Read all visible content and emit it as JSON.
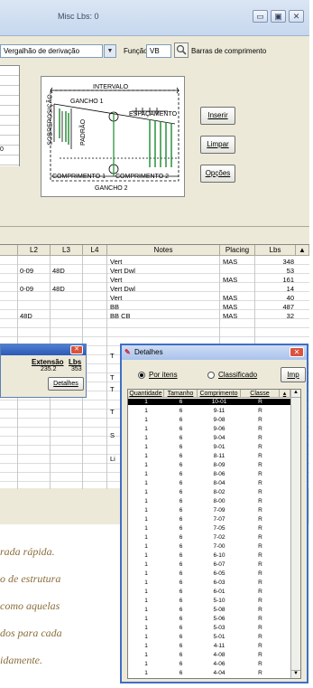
{
  "window": {
    "title": "Misc Lbs: 0",
    "minimize": "▭",
    "maximize": "▣",
    "close": "✕"
  },
  "toolbar": {
    "shape_value": "Vergalhão de derivação",
    "function_label": "Função",
    "function_value": "VB",
    "bars_label": "Barras de comprimento"
  },
  "left_panel": {
    "value": "0"
  },
  "diagram": {
    "intervalo": "INTERVALO",
    "gancho1": "GANCHO 1",
    "espacamento": "ESPAÇAMENTO",
    "sobreposicao": "SOBREPOSIÇÃO",
    "padrao": "PADRÃO",
    "comprimento1": "COMPRIMENTO 1",
    "comprimento2": "COMPRIMENTO 2",
    "gancho2": "GANCHO 2"
  },
  "buttons": {
    "inserir": "Inserir",
    "limpar": "Limpar",
    "opcoes": "Opções"
  },
  "grid": {
    "headers": [
      "L2",
      "L3",
      "L4",
      "Notes",
      "Placing",
      "Lbs"
    ],
    "rows": [
      {
        "l2": "",
        "l3": "",
        "notes": "Vert",
        "placing": "MAS",
        "lbs": "348"
      },
      {
        "l2": "0-09",
        "l3": "48D",
        "notes": "Vert Dwl",
        "placing": "",
        "lbs": "53"
      },
      {
        "l2": "",
        "l3": "",
        "notes": "Vert",
        "placing": "MAS",
        "lbs": "161"
      },
      {
        "l2": "0-09",
        "l3": "48D",
        "notes": "Vert Dwl",
        "placing": "",
        "lbs": "14"
      },
      {
        "l2": "",
        "l3": "",
        "notes": "Vert",
        "placing": "MAS",
        "lbs": "40"
      },
      {
        "l2": "",
        "l3": "",
        "notes": "BB",
        "placing": "MAS",
        "lbs": "487"
      },
      {
        "l2": "48D",
        "l3": "",
        "notes": "BB  CB",
        "placing": "MAS",
        "lbs": "32"
      }
    ],
    "partial_notes": [
      "T",
      "T",
      "T",
      "T",
      "S",
      "Li"
    ]
  },
  "small_popup": {
    "col1": "Extensão",
    "col2": "Lbs",
    "val1": "235.2",
    "val2": "353",
    "button": "Detalhes"
  },
  "captions": [
    "rada rápida.",
    "o de estrutura",
    "como aquelas",
    "dos para cada",
    "idamente."
  ],
  "detalhes": {
    "title": "Detalhes",
    "close": "✕",
    "radio_por_itens": "Por itens",
    "radio_classificado": "Classificado",
    "imp_button": "Imp",
    "headers": [
      "Quantidade",
      "Tamanho",
      "Comprimento",
      "Classe"
    ],
    "rows": [
      [
        "1",
        "6",
        "10-01",
        "R"
      ],
      [
        "1",
        "6",
        "9-11",
        "R"
      ],
      [
        "1",
        "6",
        "9-08",
        "R"
      ],
      [
        "1",
        "6",
        "9-06",
        "R"
      ],
      [
        "1",
        "6",
        "9-04",
        "R"
      ],
      [
        "1",
        "6",
        "9-01",
        "R"
      ],
      [
        "1",
        "6",
        "8-11",
        "R"
      ],
      [
        "1",
        "6",
        "8-09",
        "R"
      ],
      [
        "1",
        "6",
        "8-06",
        "R"
      ],
      [
        "1",
        "6",
        "8-04",
        "R"
      ],
      [
        "1",
        "6",
        "8-02",
        "R"
      ],
      [
        "1",
        "6",
        "8-00",
        "R"
      ],
      [
        "1",
        "6",
        "7-09",
        "R"
      ],
      [
        "1",
        "6",
        "7-07",
        "R"
      ],
      [
        "1",
        "6",
        "7-05",
        "R"
      ],
      [
        "1",
        "6",
        "7-02",
        "R"
      ],
      [
        "1",
        "6",
        "7-00",
        "R"
      ],
      [
        "1",
        "6",
        "6-10",
        "R"
      ],
      [
        "1",
        "6",
        "6-07",
        "R"
      ],
      [
        "1",
        "6",
        "6-05",
        "R"
      ],
      [
        "1",
        "6",
        "6-03",
        "R"
      ],
      [
        "1",
        "6",
        "6-01",
        "R"
      ],
      [
        "1",
        "6",
        "5-10",
        "R"
      ],
      [
        "1",
        "6",
        "5-08",
        "R"
      ],
      [
        "1",
        "6",
        "5-06",
        "R"
      ],
      [
        "1",
        "6",
        "5-03",
        "R"
      ],
      [
        "1",
        "6",
        "5-01",
        "R"
      ],
      [
        "1",
        "6",
        "4-11",
        "R"
      ],
      [
        "1",
        "6",
        "4-08",
        "R"
      ],
      [
        "1",
        "6",
        "4-06",
        "R"
      ],
      [
        "1",
        "6",
        "4-04",
        "R"
      ]
    ]
  }
}
